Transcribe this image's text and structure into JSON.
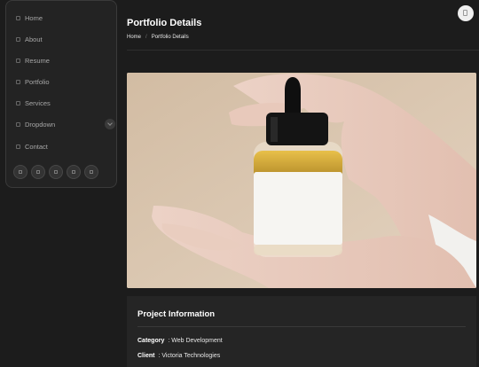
{
  "sidebar": {
    "items": [
      {
        "label": "Home",
        "icon": "house-icon"
      },
      {
        "label": "About",
        "icon": "user-icon"
      },
      {
        "label": "Resume",
        "icon": "file-icon"
      },
      {
        "label": "Portfolio",
        "icon": "images-icon"
      },
      {
        "label": "Services",
        "icon": "hdd-icon"
      },
      {
        "label": "Dropdown",
        "icon": "menu-icon"
      },
      {
        "label": "Contact",
        "icon": "envelope-icon"
      }
    ],
    "social": [
      "twitter-icon",
      "facebook-icon",
      "instagram-icon",
      "skype-icon",
      "linkedin-icon"
    ]
  },
  "header": {
    "title": "Portfolio Details",
    "breadcrumb": {
      "home": "Home",
      "separator": "/",
      "current": "Portfolio Details"
    }
  },
  "info": {
    "title": "Project Information",
    "category_label": "Category",
    "category_value": ": Web Development",
    "client_label": "Client",
    "client_value": ": Victoria Technologies"
  },
  "colors": {
    "background": "#1c1c1c",
    "sidebar": "#232323",
    "photo_background": "#d9c4ac"
  }
}
